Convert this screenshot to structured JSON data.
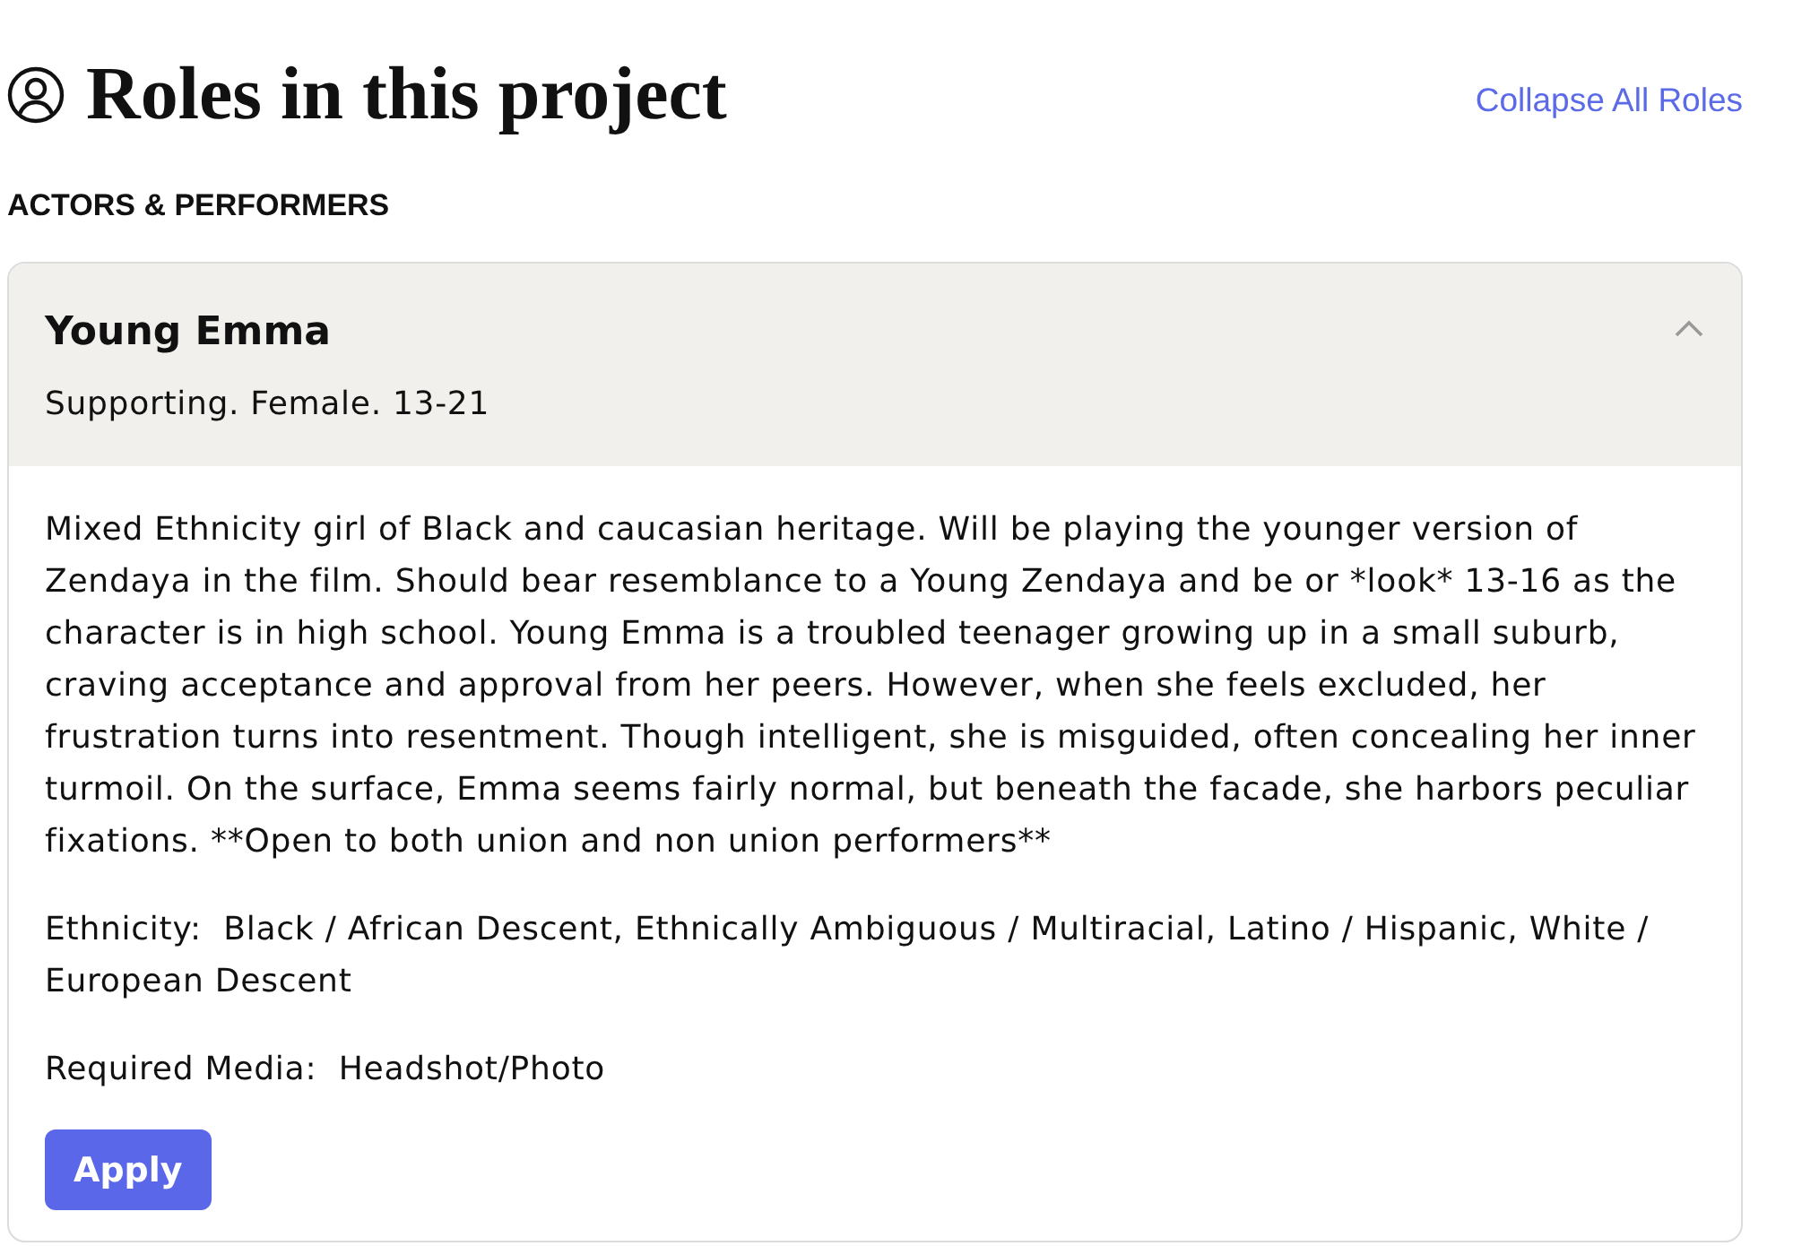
{
  "header": {
    "title": "Roles in this project",
    "collapse_link": "Collapse All Roles"
  },
  "section": {
    "heading": "ACTORS & PERFORMERS"
  },
  "roles": [
    {
      "name": "Young Emma",
      "summary": "Supporting. Female. 13-21",
      "expanded": true,
      "description": "Mixed Ethnicity girl of Black and caucasian heritage. Will be playing the younger version of Zendaya in the film. Should bear resemblance to a Young Zendaya and be or *look* 13-16 as the character is in high school. Young Emma is a troubled teenager growing up in a small suburb, craving acceptance and approval from her peers. However, when she feels excluded, her frustration turns into resentment. Though intelligent, she is misguided, often concealing her inner turmoil. On the surface, Emma seems fairly normal, but beneath the facade, she harbors peculiar fixations. **Open to both union and non union performers**",
      "details": [
        {
          "label": "Ethnicity:",
          "value": "Black / African Descent, Ethnically Ambiguous / Multiracial, Latino / Hispanic, White / European Descent"
        },
        {
          "label": "Required Media:",
          "value": "Headshot/Photo"
        }
      ],
      "apply_button": "Apply"
    }
  ]
}
